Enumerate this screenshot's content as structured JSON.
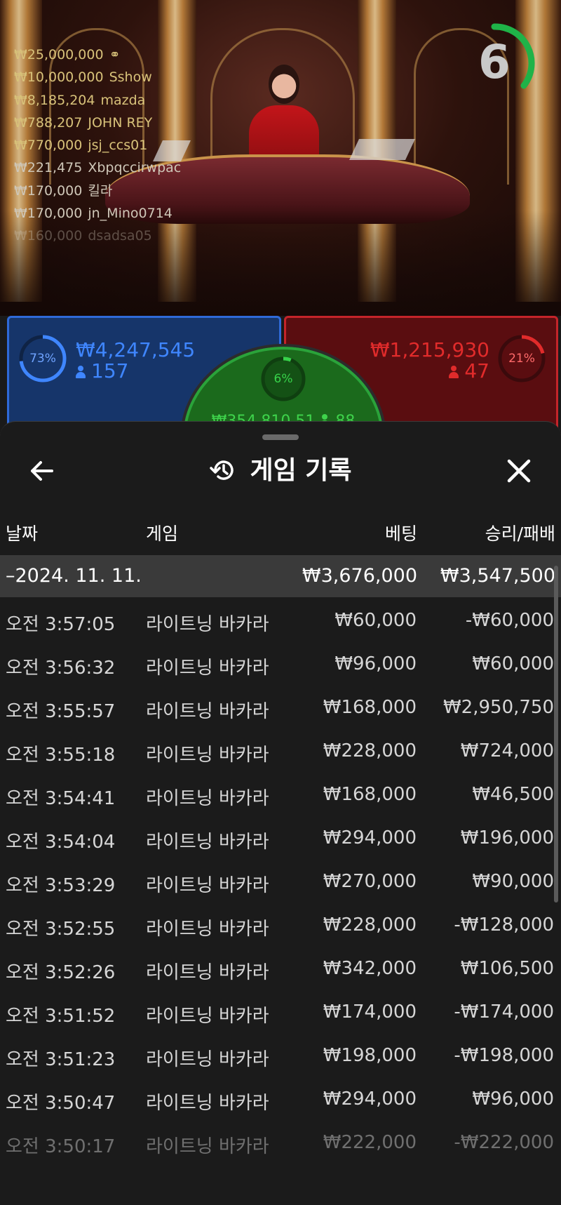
{
  "colors": {
    "player": "#2f6ad9",
    "banker": "#c4242a",
    "tie": "#2aa33a",
    "timer": "#1fb348"
  },
  "live": {
    "timer": "6",
    "top_winners": [
      {
        "amount": "₩25,000,000",
        "name": ""
      },
      {
        "amount": "₩10,000,000",
        "name": "Sshow"
      },
      {
        "amount": "₩8,185,204",
        "name": "mazda"
      },
      {
        "amount": "₩788,207",
        "name": "JOHN REY"
      },
      {
        "amount": "₩770,000",
        "name": "jsj_ccs01"
      },
      {
        "amount": "₩221,475",
        "name": "Xbpqccirwpac"
      },
      {
        "amount": "₩170,000",
        "name": "킬라"
      },
      {
        "amount": "₩170,000",
        "name": "jn_Mino0714"
      },
      {
        "amount": "₩160,000",
        "name": "dsadsa05"
      }
    ]
  },
  "bets": {
    "player": {
      "percent": "73%",
      "percent_value": 73,
      "amount": "₩4,247,545",
      "players": "157"
    },
    "tie": {
      "percent": "6%",
      "percent_value": 6,
      "amount": "₩354,810.51",
      "players": "88"
    },
    "banker": {
      "percent": "21%",
      "percent_value": 21,
      "amount": "₩1,215,930",
      "players": "47"
    }
  },
  "history": {
    "title": "게임 기록",
    "back_icon": "arrow-left-icon",
    "close_icon": "close-icon",
    "columns": {
      "date": "날짜",
      "game": "게임",
      "bet": "베팅",
      "win_loss": "승리/패배"
    },
    "summary": {
      "date": "–2024. 11. 11.",
      "bet": "₩3,676,000",
      "win_loss": "₩3,547,500"
    },
    "rows": [
      {
        "time": "오전 3:57:05",
        "game": "라이트닝 바카라",
        "bet": "₩60,000",
        "result": "-₩60,000"
      },
      {
        "time": "오전 3:56:32",
        "game": "라이트닝 바카라",
        "bet": "₩96,000",
        "result": "₩60,000"
      },
      {
        "time": "오전 3:55:57",
        "game": "라이트닝 바카라",
        "bet": "₩168,000",
        "result": "₩2,950,750"
      },
      {
        "time": "오전 3:55:18",
        "game": "라이트닝 바카라",
        "bet": "₩228,000",
        "result": "₩724,000"
      },
      {
        "time": "오전 3:54:41",
        "game": "라이트닝 바카라",
        "bet": "₩168,000",
        "result": "₩46,500"
      },
      {
        "time": "오전 3:54:04",
        "game": "라이트닝 바카라",
        "bet": "₩294,000",
        "result": "₩196,000"
      },
      {
        "time": "오전 3:53:29",
        "game": "라이트닝 바카라",
        "bet": "₩270,000",
        "result": "₩90,000"
      },
      {
        "time": "오전 3:52:55",
        "game": "라이트닝 바카라",
        "bet": "₩228,000",
        "result": "-₩128,000"
      },
      {
        "time": "오전 3:52:26",
        "game": "라이트닝 바카라",
        "bet": "₩342,000",
        "result": "₩106,500"
      },
      {
        "time": "오전 3:51:52",
        "game": "라이트닝 바카라",
        "bet": "₩174,000",
        "result": "-₩174,000"
      },
      {
        "time": "오전 3:51:23",
        "game": "라이트닝 바카라",
        "bet": "₩198,000",
        "result": "-₩198,000"
      },
      {
        "time": "오전 3:50:47",
        "game": "라이트닝 바카라",
        "bet": "₩294,000",
        "result": "₩96,000"
      },
      {
        "time": "오전 3:50:17",
        "game": "라이트닝 바카라",
        "bet": "₩222,000",
        "result": "-₩222,000"
      }
    ]
  }
}
